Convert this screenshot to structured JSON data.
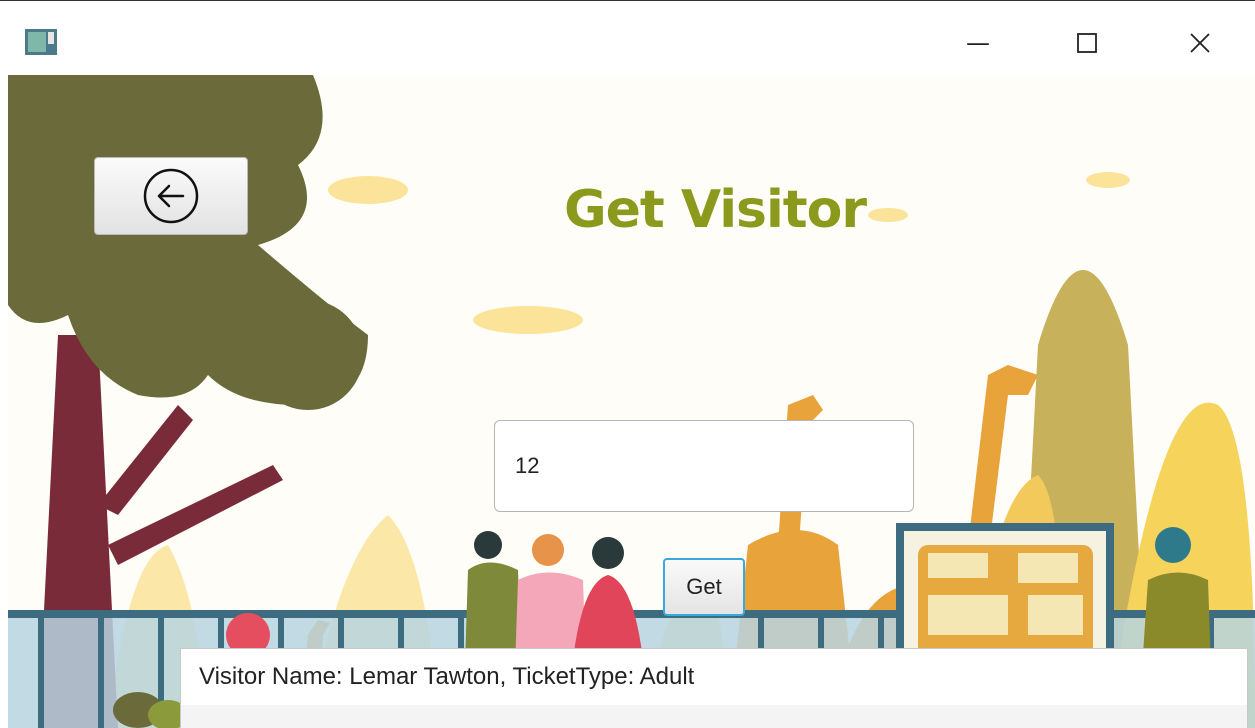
{
  "window": {
    "minimize_glyph": "—",
    "maximize_glyph": "☐",
    "close_glyph": "✕"
  },
  "page": {
    "title": "Get Visitor",
    "back_button_icon": "circle-arrow-left-icon"
  },
  "form": {
    "visitor_id_value": "12",
    "get_button_label": "Get"
  },
  "result": {
    "text": "Visitor Name: Lemar Tawton, TicketType: Adult"
  },
  "colors": {
    "title": "#8b9a1c",
    "focus_border": "#3aa9d9",
    "tree_foliage": "#6b6a3a",
    "tree_trunk": "#7a2b3a",
    "giraffe": "#e8a33a",
    "sun_cloud": "#fbe39a"
  }
}
